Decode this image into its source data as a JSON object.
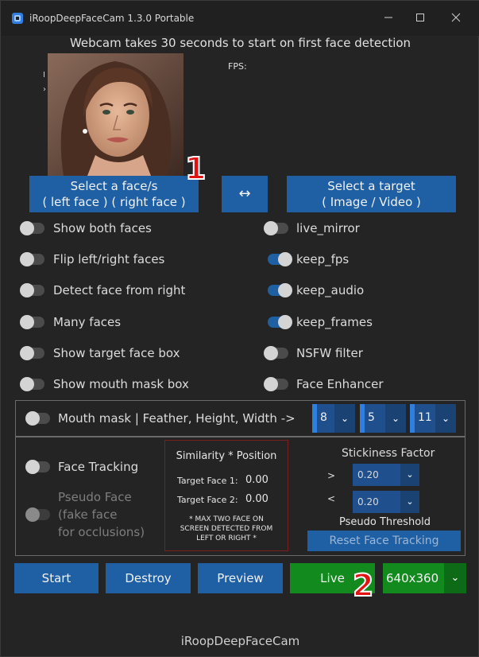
{
  "window": {
    "title": "iRoopDeepFaceCam 1.3.0 Portable",
    "controls": [
      "minimize-icon",
      "maximize-icon",
      "close-icon"
    ]
  },
  "header": {
    "info": "Webcam takes 30 seconds to start on first face detection",
    "fps_label": "FPS:"
  },
  "source_image": {
    "left_marks": [
      "I",
      "›"
    ]
  },
  "select_faces_button": {
    "line1": "Select a face/s",
    "line2": "( left face ) ( right face )"
  },
  "swap_button": {
    "label": "↔"
  },
  "select_target_button": {
    "line1": "Select a target",
    "line2": "( Image / Video )"
  },
  "badges": {
    "one": "1",
    "two": "2"
  },
  "left_toggles": [
    {
      "label": "Show both faces",
      "on": false
    },
    {
      "label": "Flip left/right faces",
      "on": false
    },
    {
      "label": "Detect face from right",
      "on": false
    },
    {
      "label": "Many faces",
      "on": false
    },
    {
      "label": "Show target face box",
      "on": false
    },
    {
      "label": "Show mouth mask box",
      "on": false
    }
  ],
  "right_toggles": [
    {
      "label": "live_mirror",
      "on": false
    },
    {
      "label": "keep_fps",
      "on": true
    },
    {
      "label": "keep_audio",
      "on": true
    },
    {
      "label": "keep_frames",
      "on": true
    },
    {
      "label": "NSFW filter",
      "on": false
    },
    {
      "label": "Face Enhancer",
      "on": false
    }
  ],
  "mouth_mask": {
    "label": "Mouth mask | Feather, Height, Width ->",
    "on": false,
    "feather": "8",
    "height": "5",
    "width": "11"
  },
  "tracking": {
    "face_tracking_label": "Face Tracking",
    "face_tracking_on": false,
    "pseudo_face_line1": "Pseudo Face",
    "pseudo_face_line2": "(fake face",
    "pseudo_face_line3": "for occlusions)",
    "pseudo_face_on": false
  },
  "similarity": {
    "title": "Similarity * Position",
    "target1_label": "Target Face 1:",
    "target1_value": "0.00",
    "target2_label": "Target Face 2:",
    "target2_value": "0.00",
    "note_line1": "* MAX TWO FACE ON",
    "note_line2": "SCREEN DETECTED FROM",
    "note_line3": "LEFT OR RIGHT *"
  },
  "stickiness": {
    "title": "Stickiness Factor",
    "gt_symbol": ">",
    "lt_symbol": "<",
    "gt_value": "0.20",
    "lt_value": "0.20",
    "pseudo_threshold_label": "Pseudo Threshold",
    "reset_button": "Reset Face Tracking"
  },
  "bottom_buttons": {
    "start": "Start",
    "destroy": "Destroy",
    "preview": "Preview",
    "live": "Live",
    "resolution": "640x360"
  },
  "footer": {
    "text": "iRoopDeepFaceCam"
  },
  "colors": {
    "accent_blue": "#1f5fa3",
    "live_green": "#128a1e",
    "badge_red": "#e11212",
    "panel_border": "#6a6a6a",
    "similarity_border": "#7a1e1e"
  }
}
